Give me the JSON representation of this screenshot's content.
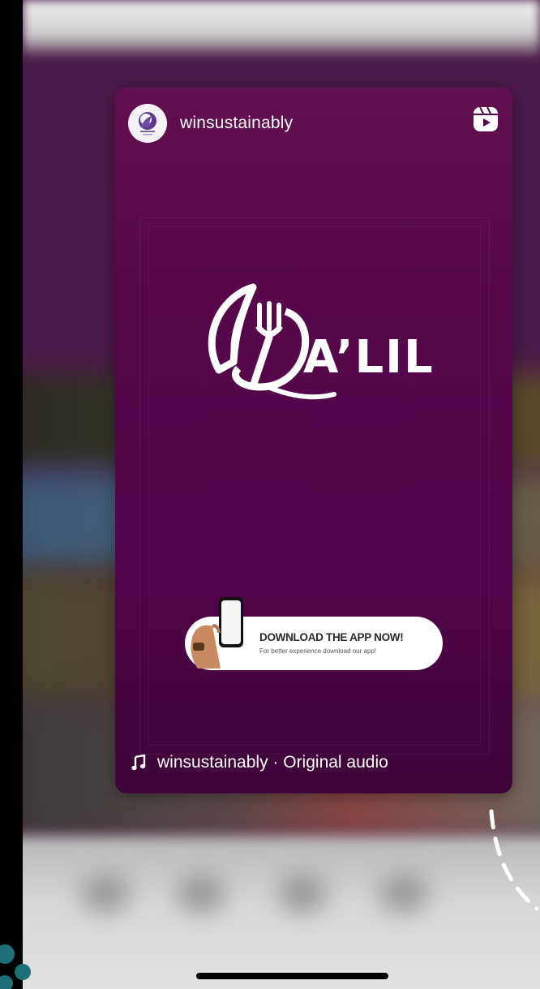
{
  "reel": {
    "username": "winsustainably",
    "brand_name": "A’LIL",
    "cta": {
      "title": "DOWNLOAD THE APP NOW!",
      "subtitle": "For better experience download our app!"
    },
    "audio_label": "winsustainably · Original audio"
  },
  "icons": {
    "reels": "reels-icon",
    "music": "music-note-icon",
    "avatar": "brand-avatar-icon"
  },
  "colors": {
    "card_purple": "#57064b",
    "accent_teal": "#1f6f77",
    "white": "#ffffff"
  }
}
